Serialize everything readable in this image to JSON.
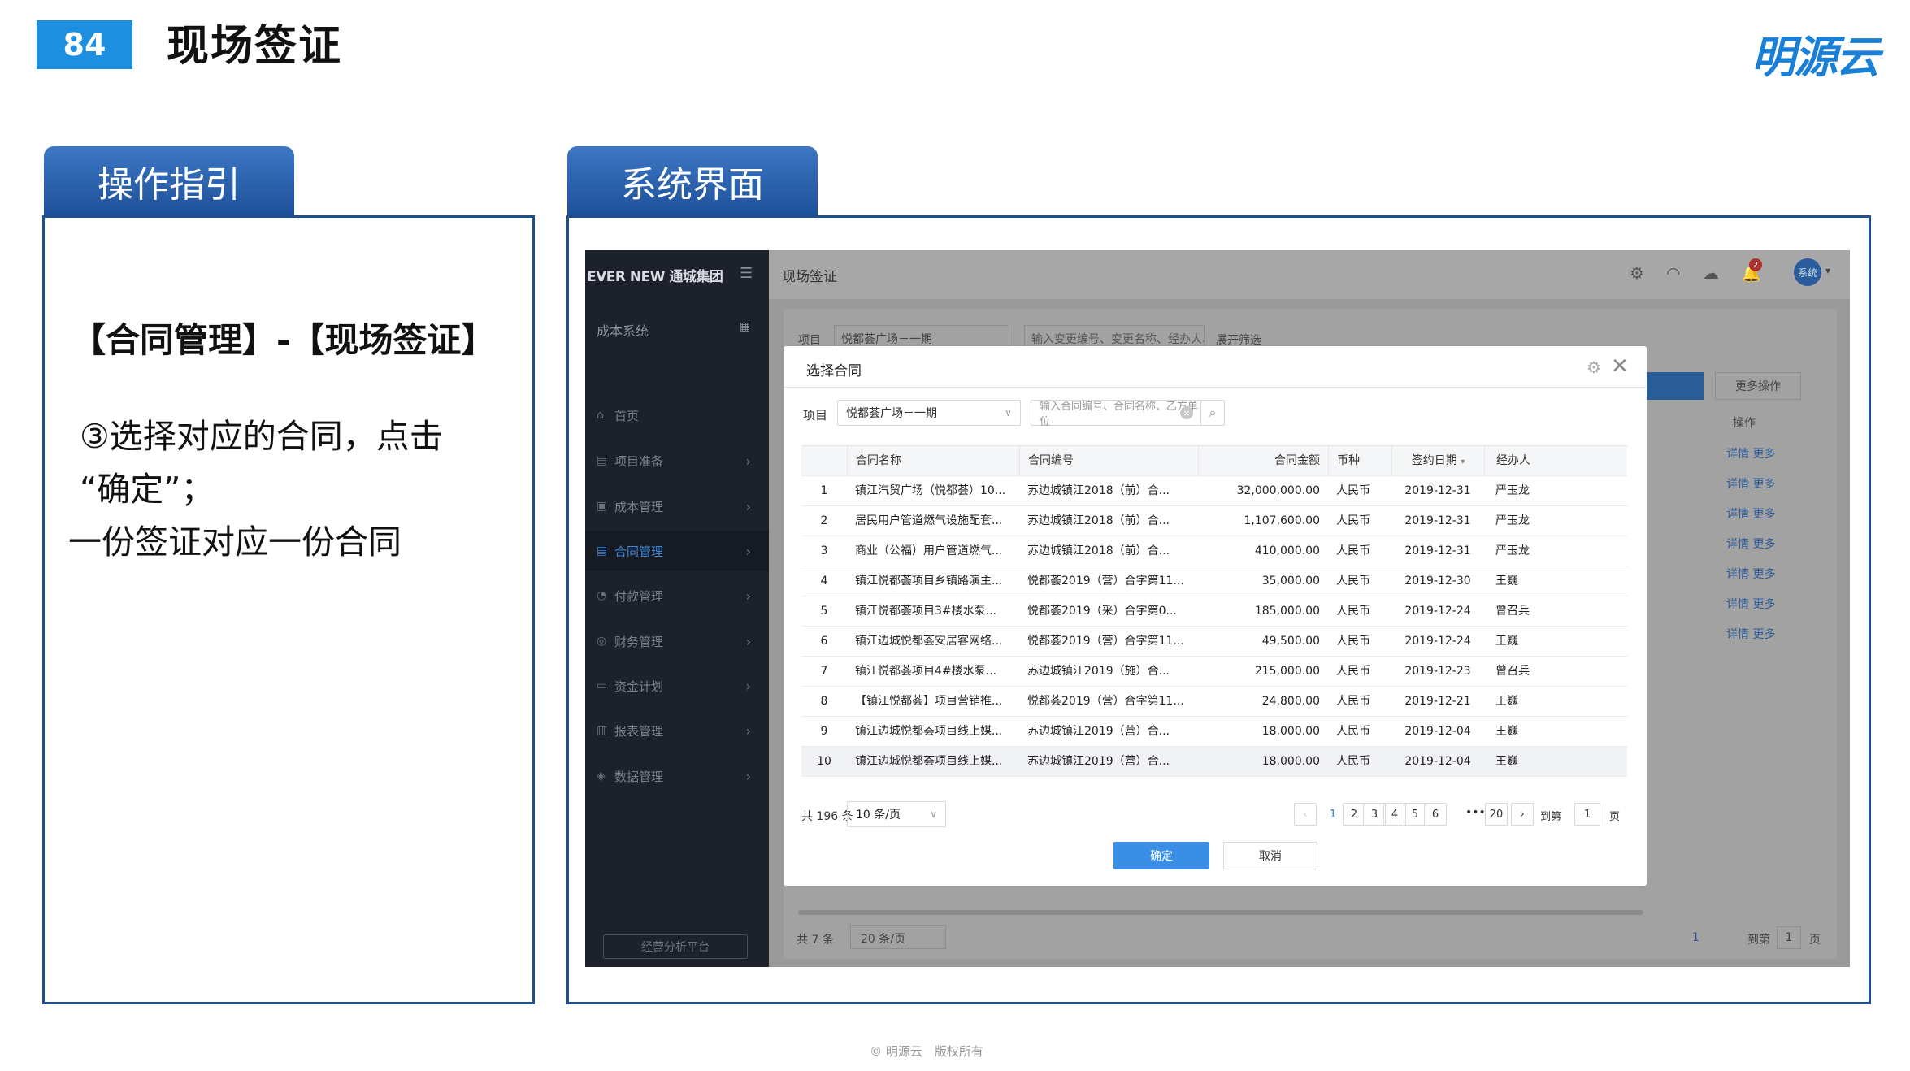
{
  "slide": {
    "number": "84",
    "title": "现场签证",
    "brand": "明源云",
    "footer": "© 明源云　版权所有"
  },
  "tabs": {
    "guide": "操作指引",
    "system_ui": "系统界面"
  },
  "guide": {
    "heading": "【合同管理】-【现场签证】",
    "line1": "③选择对应的合同，点击",
    "line2": "“确定”；",
    "line3": "一份签证对应一份合同"
  },
  "app": {
    "logo": "EVER NEW 通城集团",
    "system_title": "成本系统",
    "page_name": "现场签证",
    "avatar": "系统",
    "notify_badge": "2",
    "nav": [
      {
        "label": "首页",
        "icon": "home-icon"
      },
      {
        "label": "项目准备",
        "icon": "project-icon"
      },
      {
        "label": "成本管理",
        "icon": "cost-icon"
      },
      {
        "label": "合同管理",
        "icon": "contract-icon",
        "active": true
      },
      {
        "label": "付款管理",
        "icon": "payment-icon"
      },
      {
        "label": "财务管理",
        "icon": "finance-icon"
      },
      {
        "label": "资金计划",
        "icon": "fund-icon"
      },
      {
        "label": "报表管理",
        "icon": "report-icon"
      },
      {
        "label": "数据管理",
        "icon": "data-icon"
      }
    ],
    "platform_button": "经营分析平台",
    "background": {
      "project_label": "项目",
      "project_value": "悦都荟广场－一期",
      "search_placeholder": "输入变更编号、变更名称、经办人、合",
      "filter": "展开筛选",
      "more_ops": "更多操作",
      "col_ops": "操作",
      "row_link": "详情 更多",
      "total": "共 7 条",
      "pagesize": "20 条/页",
      "page": "1",
      "goto": "到第",
      "goto_value": "1",
      "goto_suffix": "页"
    }
  },
  "dialog": {
    "title": "选择合同",
    "project_label": "项目",
    "project_value": "悦都荟广场－一期",
    "search_placeholder": "输入合同编号、合同名称、乙方单位",
    "columns": {
      "name": "合同名称",
      "code": "合同编号",
      "amount": "合同金额",
      "currency": "币种",
      "date": "签约日期",
      "manager": "经办人"
    },
    "rows": [
      {
        "idx": "1",
        "name": "镇江汽贸广场（悦都荟）10...",
        "code": "苏边城镇江2018（前）合...",
        "amount": "32,000,000.00",
        "currency": "人民币",
        "date": "2019-12-31",
        "manager": "严玉龙"
      },
      {
        "idx": "2",
        "name": "居民用户管道燃气设施配套...",
        "code": "苏边城镇江2018（前）合...",
        "amount": "1,107,600.00",
        "currency": "人民币",
        "date": "2019-12-31",
        "manager": "严玉龙"
      },
      {
        "idx": "3",
        "name": "商业（公福）用户管道燃气...",
        "code": "苏边城镇江2018（前）合...",
        "amount": "410,000.00",
        "currency": "人民币",
        "date": "2019-12-31",
        "manager": "严玉龙"
      },
      {
        "idx": "4",
        "name": "镇江悦都荟项目乡镇路演主...",
        "code": "悦都荟2019（营）合字第11...",
        "amount": "35,000.00",
        "currency": "人民币",
        "date": "2019-12-30",
        "manager": "王巍"
      },
      {
        "idx": "5",
        "name": "镇江悦都荟项目3#楼水泵...",
        "code": "悦都荟2019（采）合字第0...",
        "amount": "185,000.00",
        "currency": "人民币",
        "date": "2019-12-24",
        "manager": "曾召兵"
      },
      {
        "idx": "6",
        "name": "镇江边城悦都荟安居客网络...",
        "code": "悦都荟2019（营）合字第11...",
        "amount": "49,500.00",
        "currency": "人民币",
        "date": "2019-12-24",
        "manager": "王巍"
      },
      {
        "idx": "7",
        "name": "镇江悦都荟项目4#楼水泵...",
        "code": "苏边城镇江2019（施）合...",
        "amount": "215,000.00",
        "currency": "人民币",
        "date": "2019-12-23",
        "manager": "曾召兵"
      },
      {
        "idx": "8",
        "name": "【镇江悦都荟】项目营销推...",
        "code": "悦都荟2019（营）合字第11...",
        "amount": "24,800.00",
        "currency": "人民币",
        "date": "2019-12-21",
        "manager": "王巍"
      },
      {
        "idx": "9",
        "name": "镇江边城悦都荟项目线上媒...",
        "code": "苏边城镇江2019（营）合...",
        "amount": "18,000.00",
        "currency": "人民币",
        "date": "2019-12-04",
        "manager": "王巍"
      },
      {
        "idx": "10",
        "name": "镇江边城悦都荟项目线上媒...",
        "code": "苏边城镇江2019（营）合...",
        "amount": "18,000.00",
        "currency": "人民币",
        "date": "2019-12-04",
        "manager": "王巍"
      }
    ],
    "pagination": {
      "total": "共 196 条",
      "pagesize": "10 条/页",
      "pages": [
        "1",
        "2",
        "3",
        "4",
        "5",
        "6"
      ],
      "last_page": "20",
      "ellipsis": "•••",
      "goto": "到第",
      "goto_value": "1",
      "goto_suffix": "页"
    },
    "ok": "确定",
    "cancel": "取消"
  }
}
